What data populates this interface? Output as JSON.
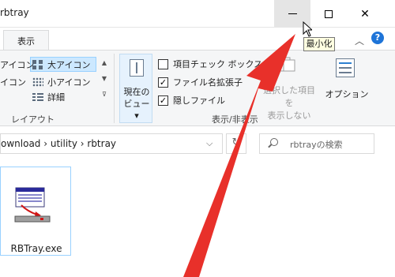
{
  "window": {
    "title": "rbtray"
  },
  "ribbon": {
    "active_tab": "表示",
    "layout_group": {
      "items": [
        {
          "label": "アイコン",
          "icon": "grid-icon"
        },
        {
          "label": "大アイコン",
          "icon": "grid-icon",
          "selected": true
        },
        {
          "label": "イコン",
          "icon": "list-icon"
        },
        {
          "label": "小アイコン",
          "icon": "dots-icon"
        },
        {
          "label": "詳細",
          "icon": "details-icon"
        }
      ],
      "label": "レイアウト"
    },
    "current_view": {
      "label_line1": "現在の",
      "label_line2": "ビュー ▾"
    },
    "show_hide_group": {
      "checkboxes": [
        {
          "label": "項目チェック ボックス",
          "checked": false
        },
        {
          "label": "ファイル名拡張子",
          "checked": true
        },
        {
          "label": "隠しファイル",
          "checked": true
        }
      ],
      "hide_selected_line1": "選択した項目を",
      "hide_selected_line2": "表示しない",
      "options_label": "オプション",
      "label": "表示/非表示"
    }
  },
  "address": {
    "path": "ownload  ›  utility  ›  rbtray",
    "search_placeholder": "rbtrayの検索"
  },
  "files": [
    {
      "name": "RBTray.exe",
      "icon": "exe-icon"
    }
  ],
  "tooltip": {
    "text": "最小化"
  },
  "colors": {
    "accent": "#1e74d8",
    "selection": "#cce8ff",
    "annotation_arrow": "#e8302a"
  }
}
